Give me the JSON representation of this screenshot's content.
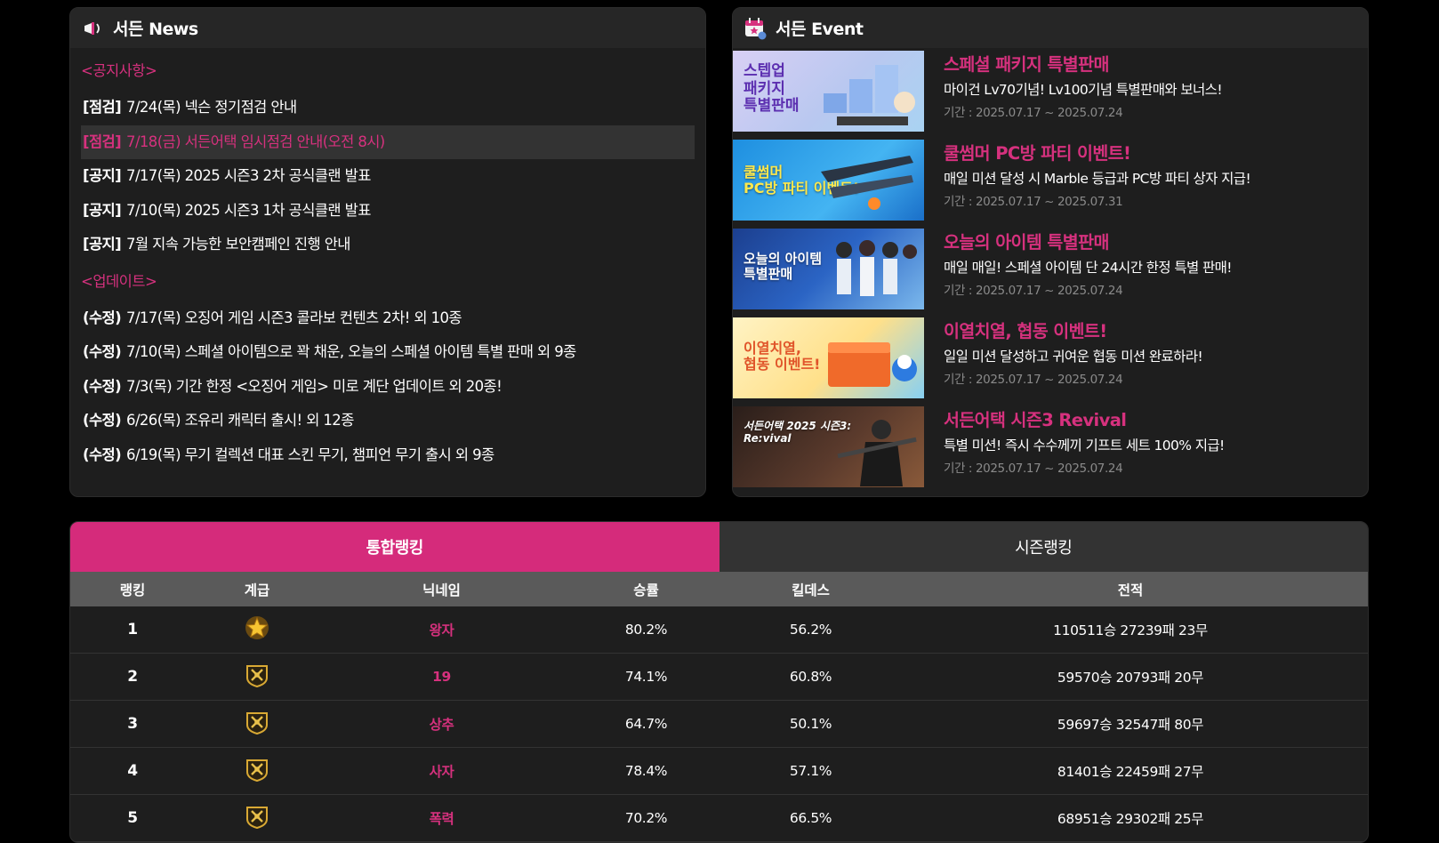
{
  "news": {
    "title": "서든 News",
    "notice_header": "<공지사항>",
    "notices": [
      {
        "tag": "[점검]",
        "text": "7/24(목) 넥슨 정기점검 안내"
      },
      {
        "tag": "[점검]",
        "text": "7/18(금) 서든어택 임시점검 안내(오전 8시)"
      },
      {
        "tag": "[공지]",
        "text": "7/17(목) 2025 시즌3 2차 공식클랜 발표"
      },
      {
        "tag": "[공지]",
        "text": "7/10(목) 2025 시즌3 1차 공식클랜 발표"
      },
      {
        "tag": "[공지]",
        "text": "7월 지속 가능한 보안캠페인 진행 안내"
      }
    ],
    "update_header": "<업데이트>",
    "updates": [
      {
        "tag": "(수정)",
        "text": "7/17(목) 오징어 게임 시즌3 콜라보 컨텐츠 2차! 외 10종"
      },
      {
        "tag": "(수정)",
        "text": "7/10(목) 스페셜 아이템으로 꽉 채운, 오늘의 스페셜 아이템 특별 판매 외 9종"
      },
      {
        "tag": "(수정)",
        "text": "7/3(목) 기간 한정 <오징어 게임> 미로 계단 업데이트 외 20종!"
      },
      {
        "tag": "(수정)",
        "text": "6/26(목) 조유리 캐릭터 출시! 외 12종"
      },
      {
        "tag": "(수정)",
        "text": "6/19(목) 무기 컬렉션 대표 스킨 무기, 챔피언 무기 출시 외 9종"
      }
    ]
  },
  "events": {
    "title": "서든 Event",
    "items": [
      {
        "img_text": "스텝업\n패키지\n특별판매",
        "title": "스페셜 패키지 특별판매",
        "desc": "마이건 Lv70기념! Lv100기념 특별판매와 보너스!",
        "period": "기간 : 2025.07.17 ~ 2025.07.24"
      },
      {
        "img_text": "쿨썸머\nPC방 파티 이벤트!",
        "title": "쿨썸머 PC방 파티 이벤트!",
        "desc": "매일 미션 달성 시 Marble 등급과 PC방 파티 상자 지급!",
        "period": "기간 : 2025.07.17 ~ 2025.07.31"
      },
      {
        "img_text": "오늘의 아이템\n특별판매",
        "title": "오늘의 아이템 특별판매",
        "desc": "매일 매일! 스페셜 아이템 단 24시간 한정 특별 판매!",
        "period": "기간 : 2025.07.17 ~ 2025.07.24"
      },
      {
        "img_text": "이열치열,\n협동 이벤트!",
        "title": "이열치열, 협동 이벤트!",
        "desc": "일일 미션 달성하고 귀여운 협동 미션 완료하라!",
        "period": "기간 : 2025.07.17 ~ 2025.07.24"
      },
      {
        "img_text": "서든어택 2025 시즌3:\nRe:vival",
        "title": "서든어택 시즌3 Revival",
        "desc": "특별 미션! 즉시 수수께끼 기프트 세트 100% 지급!",
        "period": "기간 : 2025.07.17 ~ 2025.07.24"
      }
    ]
  },
  "ranking": {
    "tabs": [
      "통합랭킹",
      "시즌랭킹"
    ],
    "columns": [
      "랭킹",
      "계급",
      "닉네임",
      "승률",
      "킬데스",
      "전적"
    ],
    "rows": [
      {
        "rank": "1",
        "grade": "star-rank-icon",
        "nick": "왕자",
        "winrate": "80.2%",
        "kd": "56.2%",
        "record": "110511승 27239패 23무"
      },
      {
        "rank": "2",
        "grade": "shield-rank-icon",
        "nick": "19",
        "winrate": "74.1%",
        "kd": "60.8%",
        "record": "59570승 20793패 20무"
      },
      {
        "rank": "3",
        "grade": "shield-rank-icon",
        "nick": "상추",
        "winrate": "64.7%",
        "kd": "50.1%",
        "record": "59697승 32547패 80무"
      },
      {
        "rank": "4",
        "grade": "shield-rank-icon",
        "nick": "사자",
        "winrate": "78.4%",
        "kd": "57.1%",
        "record": "81401승 22459패 27무"
      },
      {
        "rank": "5",
        "grade": "shield-rank-icon",
        "nick": "폭력",
        "winrate": "70.2%",
        "kd": "66.5%",
        "record": "68951승 29302패 25무"
      }
    ]
  },
  "colors": {
    "accent": "#d52b7b",
    "panel": "#1e1e1e",
    "header": "#5a5a5a"
  }
}
